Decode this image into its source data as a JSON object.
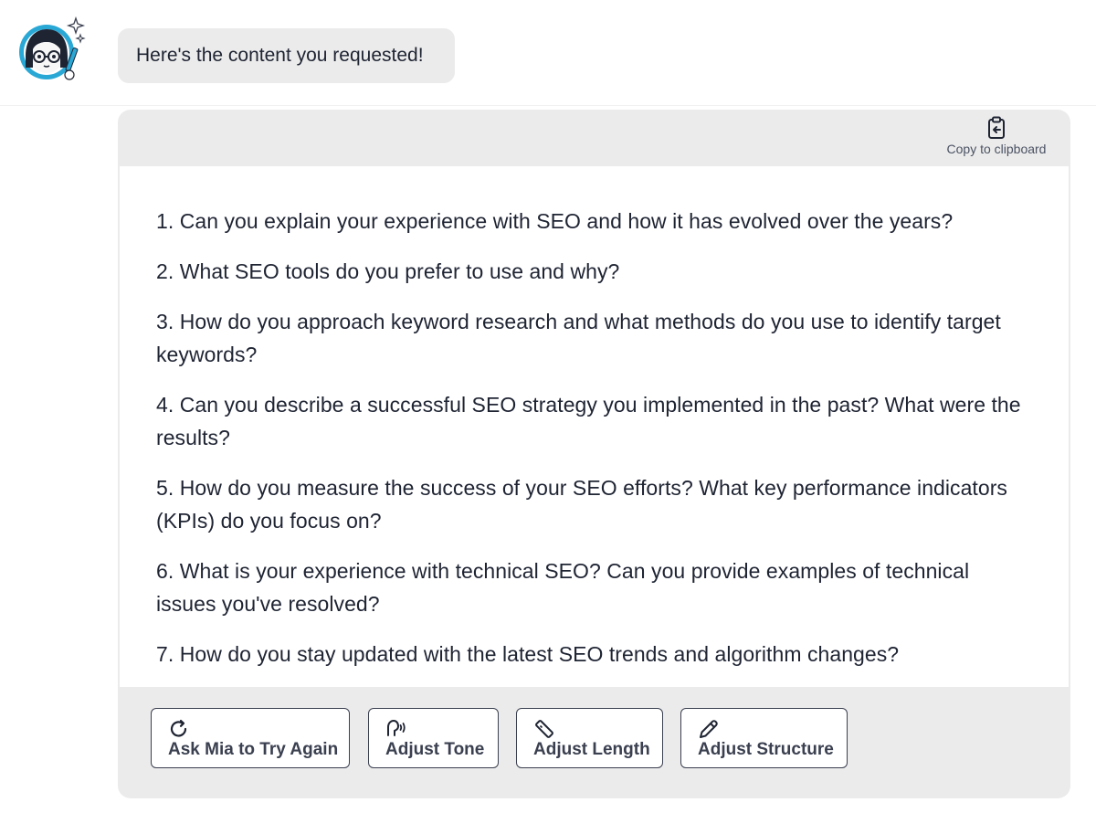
{
  "chat": {
    "greeting": "Here's the content you requested!"
  },
  "card": {
    "copy_label": "Copy to clipboard",
    "items": [
      "1. Can you explain your experience with SEO and how it has evolved over the years?",
      "2. What SEO tools do you prefer to use and why?",
      "3. How do you approach keyword research and what methods do you use to identify target keywords?",
      "4. Can you describe a successful SEO strategy you implemented in the past? What were the results?",
      "5. How do you measure the success of your SEO efforts? What key performance indicators (KPIs) do you focus on?",
      "6. What is your experience with technical SEO? Can you provide examples of technical issues you've resolved?",
      "7. How do you stay updated with the latest SEO trends and algorithm changes?"
    ],
    "actions": {
      "retry": "Ask Mia to Try Again",
      "tone": "Adjust Tone",
      "length": "Adjust Length",
      "structure": "Adjust Structure"
    }
  },
  "icons": {
    "avatar": "mia-avatar-icon",
    "copy": "clipboard-icon",
    "retry": "refresh-icon",
    "tone": "voice-icon",
    "length": "ruler-icon",
    "structure": "pen-icon"
  },
  "colors": {
    "accent": "#29a8d6",
    "bubble": "#ebebeb",
    "text": "#1f2433"
  }
}
